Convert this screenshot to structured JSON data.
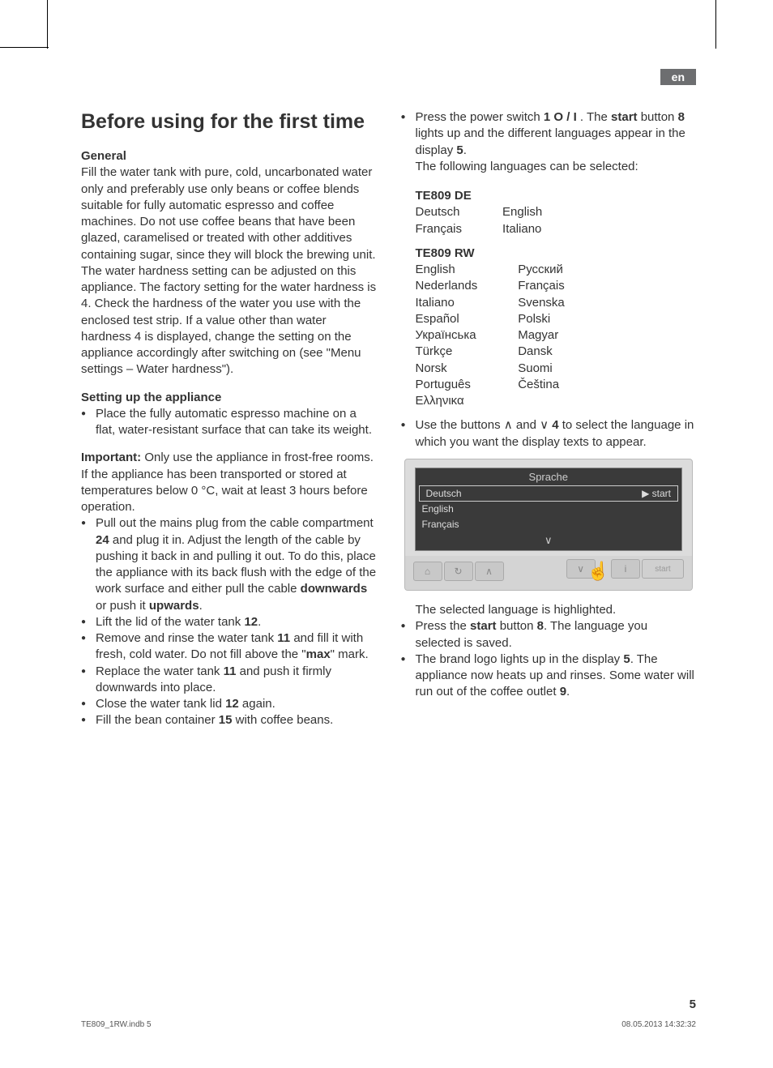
{
  "lang_badge": "en",
  "heading": "Before using for the first time",
  "left": {
    "general_label": "General",
    "general_p1": "Fill the water tank with pure, cold, uncarbonated water only and preferably use only beans or coffee blends suitable for fully automatic espresso and coffee machines. Do not use coffee beans that have been glazed, caramelised or treated with other additives containing sugar, since they will block the brewing unit.",
    "general_p2a": "The water hardness setting can be adjusted on this appliance. The factory setting for the water hardness is 4. Check the hardness of the water you use with the enclosed test strip. If a value other than water hardness 4 is displayed, change the setting on the appliance accordingly after switching on (see \"Menu settings – ",
    "general_p2b": "Water hardness",
    "general_p2c": "\").",
    "setup_label": "Setting up the appliance",
    "setup_b1": "Place the fully automatic espresso machine on a flat, water-resistant surface that can take its weight.",
    "important_label": "Important:",
    "important_text": " Only use the appliance in frost-free rooms. If the appliance has been transported or stored at temperatures below 0 °C, wait at least 3 hours before operation.",
    "b_plug_a": "Pull out the mains plug from the cable compartment ",
    "b_plug_b": "24",
    "b_plug_c": " and plug it in. Adjust the length of the cable by pushing it back in and pulling it out. To do this, place the appliance with its back flush with the edge of the work surface and either pull the cable ",
    "b_plug_d": "downwards",
    "b_plug_e": " or push it ",
    "b_plug_f": "upwards",
    "b_plug_g": ".",
    "b_lid_a": "Lift the lid of the water tank ",
    "b_lid_b": "12",
    "b_lid_c": ".",
    "b_tank_a": "Remove and rinse the water tank ",
    "b_tank_b": "11",
    "b_tank_c": " and fill it with fresh, cold water. Do not fill above the \"",
    "b_tank_d": "max",
    "b_tank_e": "\" mark.",
    "b_rep_a": "Replace the water tank ",
    "b_rep_b": "11",
    "b_rep_c": " and push it firmly downwards into place.",
    "b_close_a": "Close the water tank lid ",
    "b_close_b": "12",
    "b_close_c": " again.",
    "b_bean_a": "Fill the bean container ",
    "b_bean_b": "15",
    "b_bean_c": " with coffee beans."
  },
  "right": {
    "power_a": "Press the power switch ",
    "power_b": "1 O / I",
    "power_c": " . The ",
    "power_d": "start",
    "power_e": " button ",
    "power_f": "8",
    "power_g": " lights up and the different languages appear in the display ",
    "power_h": "5",
    "power_i": ".",
    "power_j": "The following languages can be selected:",
    "model1": "TE809 DE",
    "m1_col1": [
      "Deutsch",
      "Français"
    ],
    "m1_col2": [
      "English",
      "Italiano"
    ],
    "model2": "TE809 RW",
    "m2_col1": [
      "English",
      "Nederlands",
      "Italiano",
      "Español",
      "Українська",
      "Türkçe",
      "Norsk",
      "Português",
      "Ελληνικα"
    ],
    "m2_col2": [
      "Русский",
      "Français",
      "Svenska",
      "Polski",
      "Magyar",
      "Dansk",
      "Suomi",
      "Čeština"
    ],
    "sel_a": "Use the buttons ∧ and ∨ ",
    "sel_b": "4",
    "sel_c": " to select the language in which you want the display texts to appear.",
    "display_title": "Sprache",
    "display_langs": [
      "Deutsch",
      "English",
      "Français"
    ],
    "display_start": "▶ start",
    "btn_start": "start",
    "after1": "The selected language is highlighted.",
    "press_a": "Press the ",
    "press_b": "start",
    "press_c": " button ",
    "press_d": "8",
    "press_e": ". The language you selected is saved.",
    "brand_a": "The brand logo lights up in the display ",
    "brand_b": "5",
    "brand_c": ". The appliance now heats up and rinses. Some water will run out of the coffee outlet ",
    "brand_d": "9",
    "brand_e": "."
  },
  "page_number": "5",
  "footer_left": "TE809_1RW.indb   5",
  "footer_right": "08.05.2013   14:32:32"
}
